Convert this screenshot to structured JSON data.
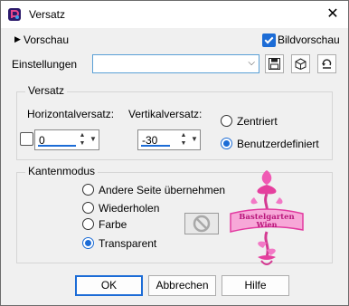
{
  "window": {
    "title": "Versatz",
    "close_glyph": "✕"
  },
  "preview": {
    "label": "Vorschau",
    "arrow": "▶"
  },
  "bildvorschau": {
    "label": "Bildvorschau",
    "checked": true
  },
  "settings": {
    "label": "Einstellungen",
    "value": "",
    "dropdown_glyph": "⌵"
  },
  "toolbar": {
    "save_icon": "floppy-disk-icon",
    "cube_icon": "cube-icon",
    "reset_icon": "reset-icon"
  },
  "offset": {
    "group_label": "Versatz",
    "horizontal": {
      "label": "Horizontalversatz:",
      "value": "0"
    },
    "vertical": {
      "label": "Vertikalversatz:",
      "value": "-30"
    },
    "centered_label": "Zentriert",
    "custom_label": "Benutzerdefiniert",
    "selected": "custom"
  },
  "edge_mode": {
    "group_label": "Kantenmodus",
    "options": [
      "Andere Seite übernehmen",
      "Wiederholen",
      "Farbe",
      "Transparent"
    ],
    "selected_index": 3
  },
  "watermark": {
    "line1": "Bastelgarten",
    "line2": "Wien"
  },
  "buttons": {
    "ok": "OK",
    "cancel": "Abbrechen",
    "help": "Hilfe"
  }
}
